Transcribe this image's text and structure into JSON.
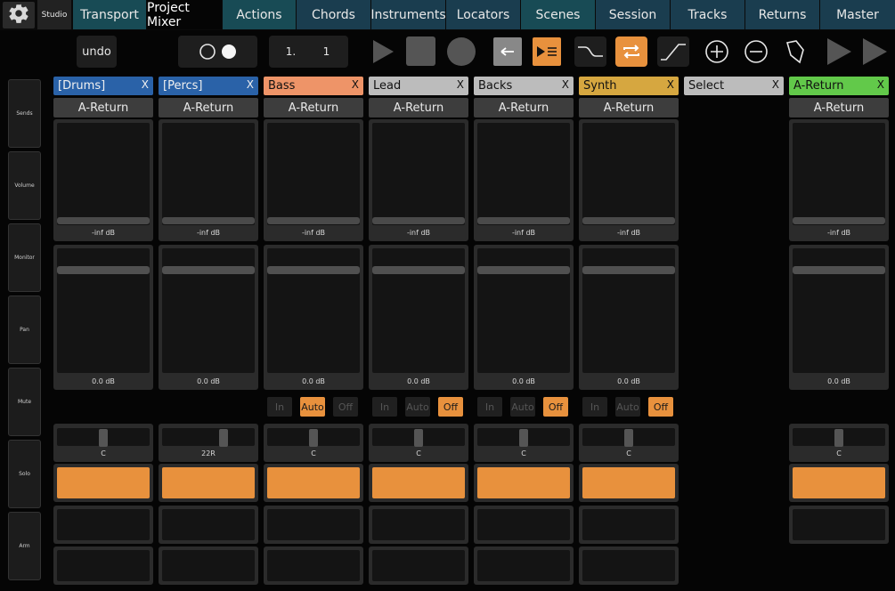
{
  "nav": {
    "studio": "Studio",
    "tabs": [
      {
        "label": "Transport",
        "active": false
      },
      {
        "label": "Project Mixer",
        "active": true
      },
      {
        "label": "Actions",
        "active": false
      },
      {
        "label": "Chords",
        "active": false
      },
      {
        "label": "Instruments",
        "active": false
      },
      {
        "label": "Locators",
        "active": false
      },
      {
        "label": "Scenes",
        "active": false
      },
      {
        "label": "Session",
        "active": false
      },
      {
        "label": "Tracks",
        "active": false
      },
      {
        "label": "Returns",
        "active": false
      },
      {
        "label": "Master",
        "active": false
      }
    ]
  },
  "transport": {
    "undo_label": "undo",
    "position_bar": "1.",
    "position_beat": "1",
    "icons": [
      "circle-outline-icon",
      "circle-filled-icon",
      "play-icon",
      "stop-icon",
      "record-icon",
      "arrow-left-icon",
      "follow-icon",
      "curve-down-icon",
      "loop-icon",
      "curve-up-icon",
      "add-icon",
      "remove-icon",
      "tag-icon",
      "forward-icon",
      "forward-icon"
    ],
    "accent_color": "#e8913d"
  },
  "sidebar": {
    "items": [
      {
        "label": "Sends"
      },
      {
        "label": "Volume"
      },
      {
        "label": "Monitor"
      },
      {
        "label": "Pan"
      },
      {
        "label": "Mute"
      },
      {
        "label": "Solo"
      },
      {
        "label": "Arm"
      }
    ]
  },
  "strips": [
    {
      "name": "[Drums]",
      "close": "X",
      "color": "#2a62a8",
      "text_color": "#f0f0f0",
      "send": "A-Return",
      "send_db": "-inf dB",
      "vol_db": "0.0 dB",
      "monitor": null,
      "pan": "C",
      "pan_pos": 0.5,
      "mute_on": true,
      "solo": true,
      "arm": true
    },
    {
      "name": "[Percs]",
      "close": "X",
      "color": "#2a62a8",
      "text_color": "#f0f0f0",
      "send": "A-Return",
      "send_db": "-inf dB",
      "vol_db": "0.0 dB",
      "monitor": null,
      "pan": "22R",
      "pan_pos": 0.68,
      "mute_on": true,
      "solo": true,
      "arm": true
    },
    {
      "name": "Bass",
      "close": "X",
      "color": "#ee9468",
      "text_color": "#111111",
      "send": "A-Return",
      "send_db": "-inf dB",
      "vol_db": "0.0 dB",
      "monitor": {
        "in": "In",
        "auto": "Auto",
        "off": "Off",
        "active": "auto"
      },
      "pan": "C",
      "pan_pos": 0.5,
      "mute_on": true,
      "solo": true,
      "arm": true
    },
    {
      "name": "Lead",
      "close": "X",
      "color": "#bcbcbc",
      "text_color": "#111111",
      "send": "A-Return",
      "send_db": "-inf dB",
      "vol_db": "0.0 dB",
      "monitor": {
        "in": "In",
        "auto": "Auto",
        "off": "Off",
        "active": "off"
      },
      "pan": "C",
      "pan_pos": 0.5,
      "mute_on": true,
      "solo": true,
      "arm": true
    },
    {
      "name": "Backs",
      "close": "X",
      "color": "#bcbcbc",
      "text_color": "#111111",
      "send": "A-Return",
      "send_db": "-inf dB",
      "vol_db": "0.0 dB",
      "monitor": {
        "in": "In",
        "auto": "Auto",
        "off": "Off",
        "active": "off"
      },
      "pan": "C",
      "pan_pos": 0.5,
      "mute_on": true,
      "solo": true,
      "arm": true
    },
    {
      "name": "Synth",
      "close": "X",
      "color": "#d6a740",
      "text_color": "#111111",
      "send": "A-Return",
      "send_db": "-inf dB",
      "vol_db": "0.0 dB",
      "monitor": {
        "in": "In",
        "auto": "Auto",
        "off": "Off",
        "active": "off"
      },
      "pan": "C",
      "pan_pos": 0.5,
      "mute_on": true,
      "solo": true,
      "arm": true
    },
    {
      "name": "Select",
      "close": "X",
      "color": "#bcbcbc",
      "text_color": "#111111",
      "empty": true
    },
    {
      "name": "A-Return",
      "close": "X",
      "color": "#62c94a",
      "text_color": "#111111",
      "send": "A-Return",
      "send_db": "-inf dB",
      "vol_db": "0.0 dB",
      "monitor": null,
      "pan": "C",
      "pan_pos": 0.5,
      "mute_on": true,
      "solo": true,
      "arm": false
    }
  ]
}
